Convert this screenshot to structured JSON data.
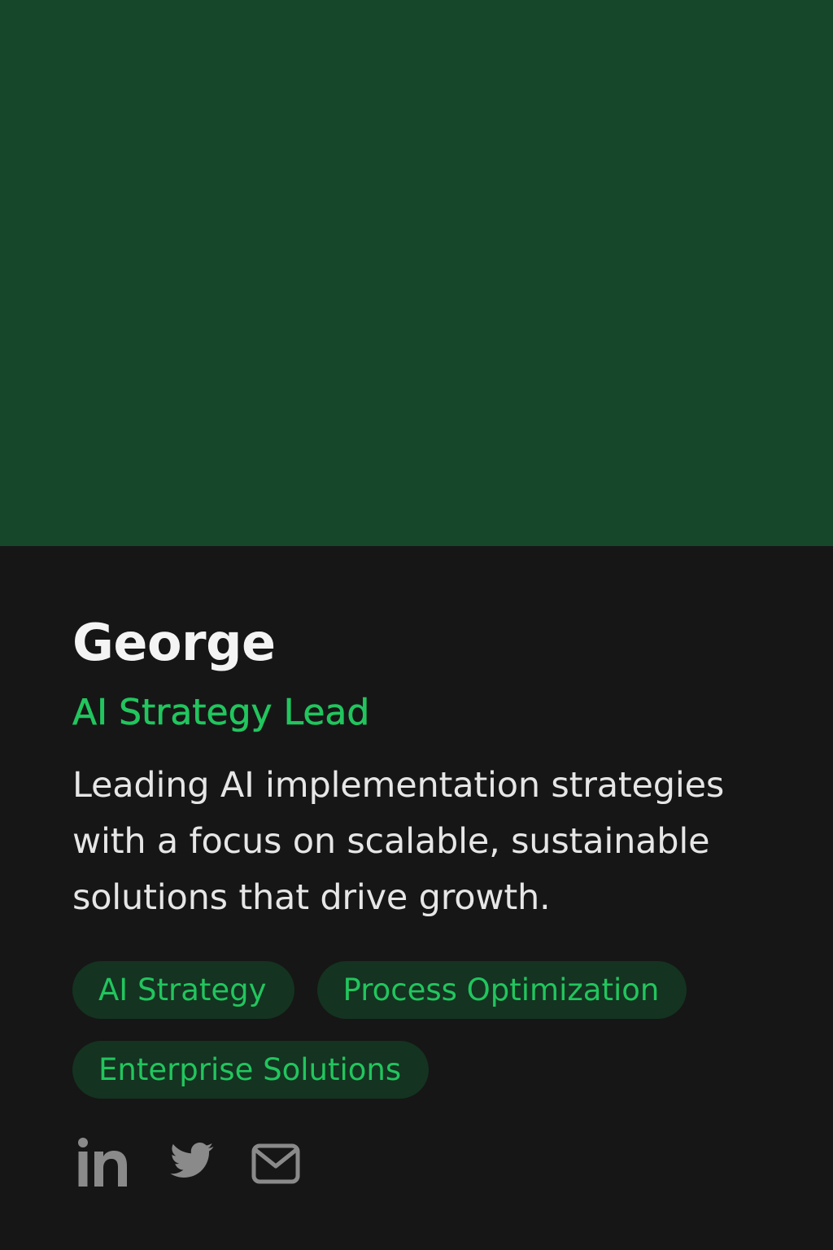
{
  "profile": {
    "name": "George",
    "role": "AI Strategy Lead",
    "bio": "Leading AI implementation strategies with a focus on scalable, sustainable solutions that drive growth."
  },
  "tags": [
    "AI Strategy",
    "Process Optimization",
    "Enterprise Solutions"
  ],
  "social": [
    {
      "icon": "linkedin-icon"
    },
    {
      "icon": "twitter-icon"
    },
    {
      "icon": "mail-icon"
    }
  ],
  "colors": {
    "hero": "#17472a",
    "card_background": "#161616",
    "accent": "#22c55e",
    "tag_background": "#143320",
    "icon": "#8a8a8a"
  }
}
